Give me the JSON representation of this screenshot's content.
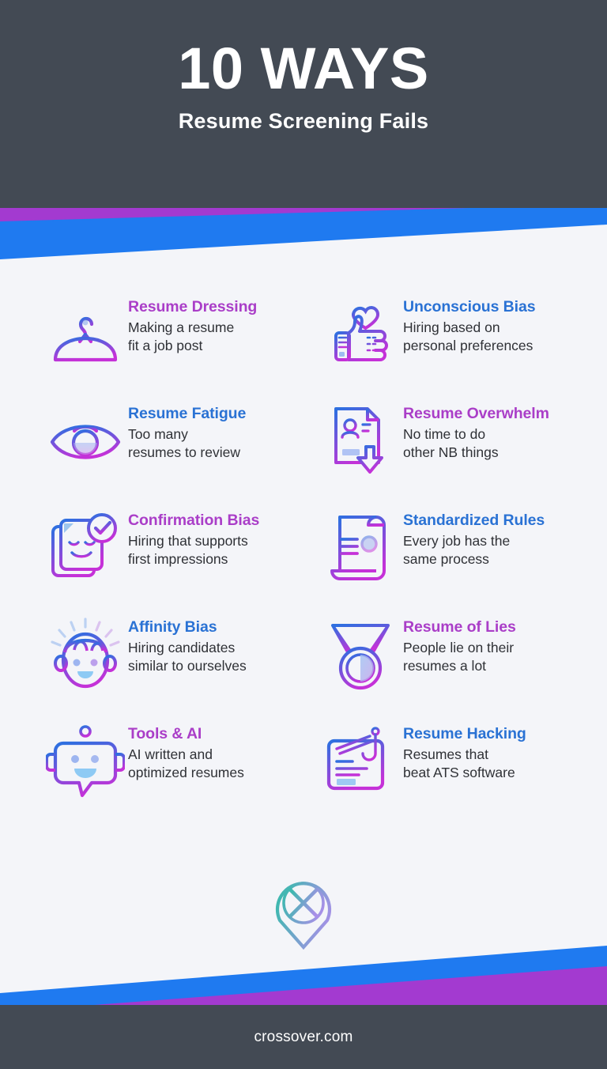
{
  "header": {
    "title_main": "10 WAYS",
    "title_sub": "Resume Screening Fails",
    "bg_color": "#434a54"
  },
  "theme": {
    "page_bg": "#f4f5f9",
    "purple": "#aa3ec8",
    "blue": "#2a72d4",
    "band_purple": "#a33ad0",
    "band_blue": "#1f7af0",
    "body_text": "#2f3136",
    "icon_gradient_start": "#2f6fe0",
    "icon_gradient_end": "#c531d8"
  },
  "items": [
    {
      "title": "Resume Dressing",
      "title_color": "purple",
      "desc": "Making a resume\nfit a job post",
      "icon": "hanger-icon"
    },
    {
      "title": "Unconscious Bias",
      "title_color": "blue",
      "desc": "Hiring based on\npersonal preferences",
      "icon": "thumbs-up-heart-icon"
    },
    {
      "title": "Resume Fatigue",
      "title_color": "blue",
      "desc": "Too many\nresumes to review",
      "icon": "tired-eye-icon"
    },
    {
      "title": "Resume Overwhelm",
      "title_color": "purple",
      "desc": "No time to do\nother NB things",
      "icon": "resume-download-icon"
    },
    {
      "title": "Confirmation Bias",
      "title_color": "purple",
      "desc": "Hiring that supports\nfirst impressions",
      "icon": "checked-profile-cards-icon"
    },
    {
      "title": "Standardized Rules",
      "title_color": "blue",
      "desc": "Every job has the\nsame process",
      "icon": "scroll-document-icon"
    },
    {
      "title": "Affinity Bias",
      "title_color": "blue",
      "desc": "Hiring candidates\nsimilar to ourselves",
      "icon": "smiling-face-icon"
    },
    {
      "title": "Resume of Lies",
      "title_color": "purple",
      "desc": "People lie on their\nresumes a lot",
      "icon": "medal-icon"
    },
    {
      "title": "Tools & AI",
      "title_color": "purple",
      "desc": "AI written and\noptimized resumes",
      "icon": "robot-chat-icon"
    },
    {
      "title": "Resume Hacking",
      "title_color": "blue",
      "desc": "Resumes that\nbeat ATS software",
      "icon": "hacked-document-icon"
    }
  ],
  "logo": {
    "name": "crossover-logo-icon",
    "gradient_start": "#3fb8b0",
    "gradient_end": "#a98fe8"
  },
  "footer": {
    "text": "crossover.com",
    "bg_color": "#434a54"
  }
}
